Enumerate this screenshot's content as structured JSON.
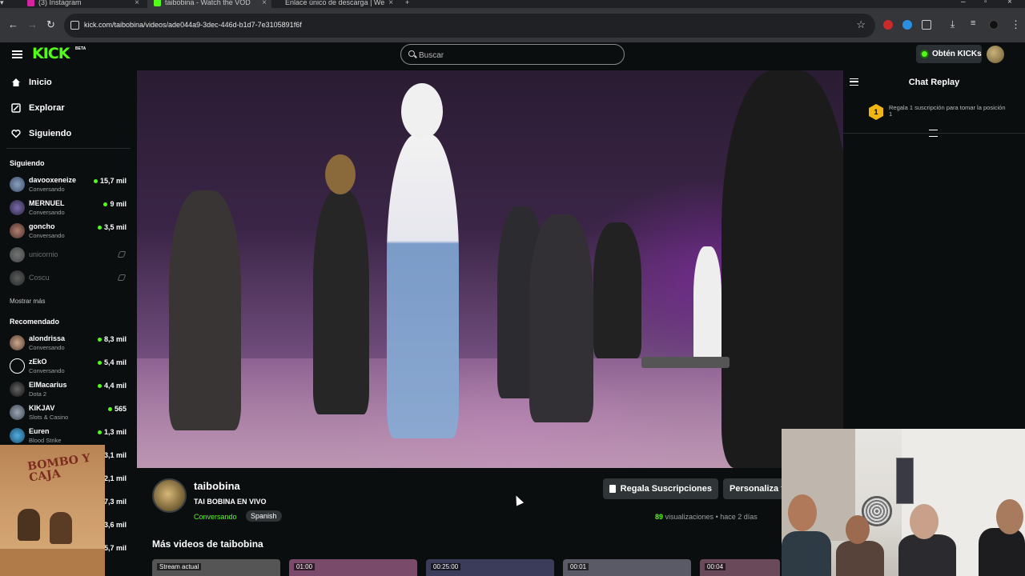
{
  "browser": {
    "tabs": [
      {
        "title": "(3) Instagram",
        "active": false,
        "icon": "instagram-icon"
      },
      {
        "title": "taibobina - Watch the VOD",
        "active": true,
        "icon": "kick-icon"
      },
      {
        "title": "Enlace único de descarga | We",
        "active": false,
        "icon": "globe-icon"
      }
    ],
    "new_tab": "+",
    "url": "kick.com/taibobina/videos/ade044a9-3dec-446d-b1d7-7e3105891f6f"
  },
  "header": {
    "logo": "KICK",
    "beta": "BETA",
    "search_placeholder": "Buscar",
    "kicks_button": "Obtén KICKs",
    "accent": "#53fc18"
  },
  "sidebar": {
    "nav": [
      {
        "label": "Inicio",
        "icon": "home-icon"
      },
      {
        "label": "Explorar",
        "icon": "compass-icon"
      },
      {
        "label": "Siguiendo",
        "icon": "heart-icon"
      }
    ],
    "following_title": "Siguiendo",
    "following": [
      {
        "name": "davooxeneize",
        "category": "Conversando",
        "viewers": "15,7 mil",
        "live": true
      },
      {
        "name": "MERNUEL",
        "category": "Conversando",
        "viewers": "9 mil",
        "live": true
      },
      {
        "name": "goncho",
        "category": "Conversando",
        "viewers": "3,5 mil",
        "live": true
      },
      {
        "name": "unicornio",
        "category": "",
        "viewers": "",
        "live": false
      },
      {
        "name": "Coscu",
        "category": "",
        "viewers": "",
        "live": false
      }
    ],
    "show_more": "Mostrar más",
    "recommended_title": "Recomendado",
    "recommended": [
      {
        "name": "alondrissa",
        "category": "Conversando",
        "viewers": "8,3 mil"
      },
      {
        "name": "zEkO",
        "category": "Conversando",
        "viewers": "5,4 mil"
      },
      {
        "name": "ElMacarius",
        "category": "Dota 2",
        "viewers": "4,4 mil"
      },
      {
        "name": "KIKJAV",
        "category": "Slots & Casino",
        "viewers": "565"
      },
      {
        "name": "Euren",
        "category": "Blood Strike",
        "viewers": "1,3 mil"
      }
    ],
    "hidden_viewers": [
      "3,1 mil",
      "2,1 mil",
      "7,3 mil",
      "3,6 mil",
      "5,7 mil"
    ],
    "poster_text": "BOMBO Y CAJA"
  },
  "channel": {
    "name": "taibobina",
    "title": "TAI BOBINA EN VIVO",
    "category": "Conversando",
    "tag": "Spanish",
    "gift_button": "Regala Suscripciones",
    "customize_button": "Personaliza t",
    "views_count": "89",
    "views_label": "visualizaciones",
    "separator": "•",
    "time_ago": "hace 2 días",
    "more_videos": "Más videos de taibobina",
    "thumbs": [
      "Stream actual",
      "01:00",
      "00:25:00",
      "00:01",
      "00:04"
    ]
  },
  "chat": {
    "title": "Chat Replay",
    "gift_position": "1",
    "gift_text": "Regala 1 suscripción para tomar la posición 1"
  }
}
